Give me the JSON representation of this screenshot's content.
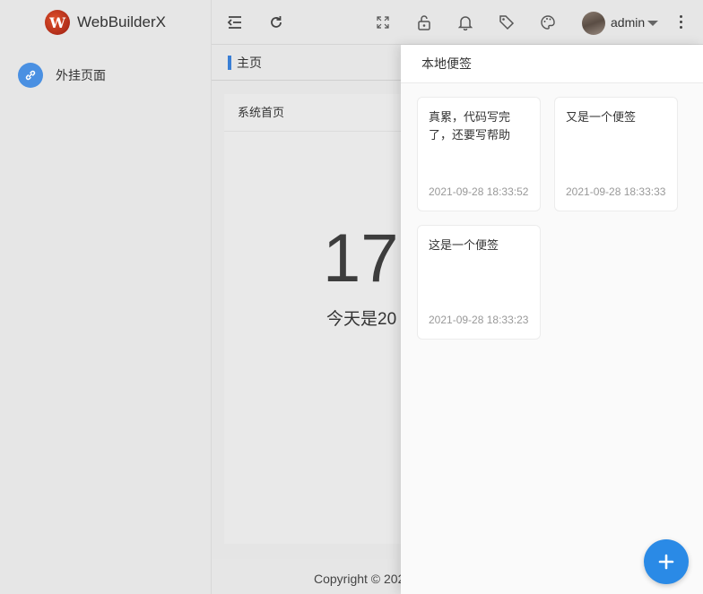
{
  "app": {
    "title": "WebBuilderX",
    "logo_letter": "W"
  },
  "sidebar": {
    "items": [
      {
        "label": "外挂页面",
        "icon": "link-icon"
      }
    ]
  },
  "header": {
    "icons": [
      "menu-collapse-icon",
      "refresh-icon",
      "fullscreen-icon",
      "lock-icon",
      "bell-icon",
      "tag-icon",
      "palette-icon"
    ],
    "user": {
      "name": "admin"
    }
  },
  "tabs": [
    {
      "label": "主页",
      "active": true
    }
  ],
  "main": {
    "card_title": "系统首页",
    "big_number": "17",
    "today_text": "今天是20"
  },
  "footer": {
    "copyright": "Copyright © 202"
  },
  "notes_panel": {
    "title": "本地便签",
    "notes": [
      {
        "text": "真累，代码写完了，还要写帮助",
        "time": "2021-09-28 18:33:52"
      },
      {
        "text": "又是一个便签",
        "time": "2021-09-28 18:33:33"
      },
      {
        "text": "这是一个便签",
        "time": "2021-09-28 18:33:23"
      }
    ],
    "add_icon": "plus-icon"
  },
  "colors": {
    "accent": "#3a7fd5",
    "fab": "#2a8ae6"
  }
}
